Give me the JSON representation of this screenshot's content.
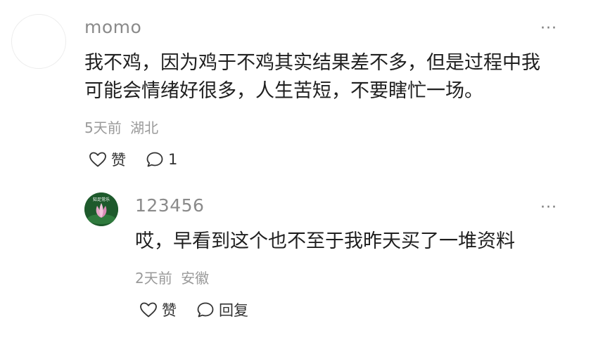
{
  "comment": {
    "username": "momo",
    "text": "我不鸡，因为鸡于不鸡其实结果差不多，但是过程中我\n可能会情绪好很多，人生苦短，不要瞎忙一场。",
    "time": "5天前",
    "location": "湖北",
    "like_label": "赞",
    "comment_count": "1",
    "more_label": "···"
  },
  "reply": {
    "username": "123456",
    "avatar_text": "知足常乐",
    "text": "哎，早看到这个也不至于我昨天买了一堆资料",
    "time": "2天前",
    "location": "安徽",
    "like_label": "赞",
    "reply_label": "回复",
    "more_label": "···"
  }
}
